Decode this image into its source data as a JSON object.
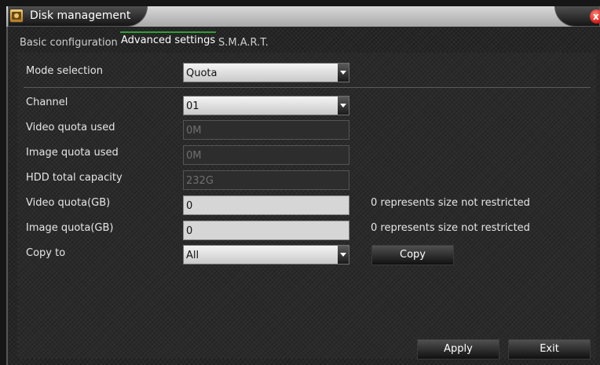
{
  "window": {
    "title": "Disk management",
    "close_symbol": "x",
    "icon": "disk-icon"
  },
  "tabs": [
    {
      "label": "Basic configuration",
      "active": false
    },
    {
      "label": "Advanced settings",
      "active": true
    },
    {
      "label": "S.M.A.R.T.",
      "active": false
    }
  ],
  "form": {
    "mode_selection": {
      "label": "Mode selection",
      "value": "Quota"
    },
    "channel": {
      "label": "Channel",
      "value": "01"
    },
    "video_quota_used": {
      "label": "Video quota used",
      "value": "0M"
    },
    "image_quota_used": {
      "label": "Image quota used",
      "value": "0M"
    },
    "hdd_total_capacity": {
      "label": "HDD total capacity",
      "value": "232G"
    },
    "video_quota": {
      "label": "Video quota(GB)",
      "value": "0",
      "note": "0 represents size not restricted"
    },
    "image_quota": {
      "label": "Image quota(GB)",
      "value": "0",
      "note": "0 represents size not restricted"
    },
    "copy_to": {
      "label": "Copy to",
      "value": "All",
      "button": "Copy"
    }
  },
  "footer": {
    "apply": "Apply",
    "exit": "Exit"
  },
  "colors": {
    "active_tab_accent": "#2f9e33",
    "close_button": "#d01818"
  }
}
